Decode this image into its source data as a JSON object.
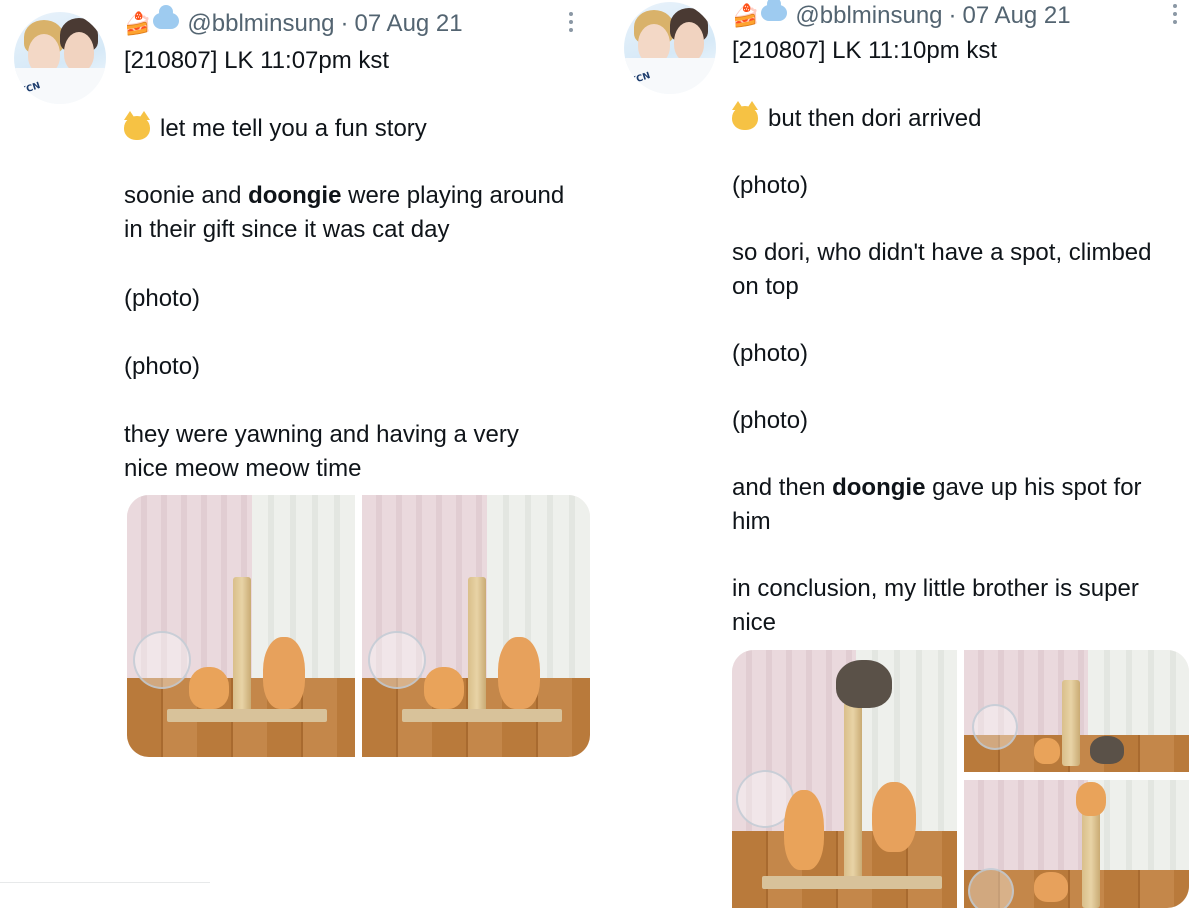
{
  "tweets": [
    {
      "handle": "@bblminsung",
      "date": "07 Aug 21",
      "separator": "·",
      "title_line": "[210807] LK 11:07pm kst",
      "lines": {
        "l1": "let me tell you a fun story",
        "l2a": "soonie and ",
        "l2b": "doongie",
        "l2c": " were playing around",
        "l3": "in their gift since it was cat day",
        "l4": "(photo)",
        "l5": "(photo)",
        "l6": "they were yawning and having a very",
        "l7": "nice meow meow time"
      },
      "icons": [
        "cake-emoji",
        "cloud-emoji",
        "cat-emoji",
        "more-options-icon"
      ]
    },
    {
      "handle": "@bblminsung",
      "date": "07 Aug 21",
      "separator": "·",
      "title_line": "[210807] LK 11:10pm kst",
      "lines": {
        "l1": "but then dori arrived",
        "l2": "(photo)",
        "l3": "so dori, who didn't have a spot, climbed",
        "l4": "on top",
        "l5": "(photo)",
        "l6": "(photo)",
        "l7a": "and then ",
        "l7b": "doongie",
        "l7c": " gave up his spot for",
        "l8": "him",
        "l9": "in conclusion, my little brother is super",
        "l10": "nice"
      },
      "icons": [
        "cake-emoji",
        "cloud-emoji",
        "cat-emoji",
        "more-options-icon"
      ]
    }
  ],
  "avatar_logo_text": "KCN",
  "colors": {
    "text": "#0f1419",
    "secondary": "#536471",
    "curtain_pink": "#ead9dd",
    "floor_wood": "#b97a3b",
    "cat_orange": "#e9a35a",
    "cat_tabby": "#5a5148"
  }
}
